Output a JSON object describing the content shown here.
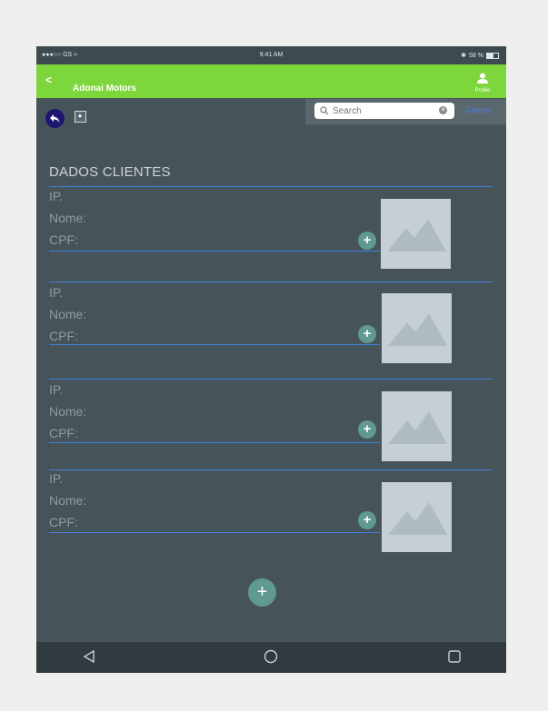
{
  "status_bar": {
    "carrier": "●●●○○ GS",
    "time": "9:41 AM",
    "battery": "58 %"
  },
  "app_bar": {
    "back_label": "<",
    "title": "Adonai Motors",
    "profile_label": "Profile"
  },
  "search": {
    "placeholder": "Search",
    "value": "Search",
    "cancel_label": "Cancel"
  },
  "section_title": "DADOS CLIENTES",
  "clients": [
    {
      "ip_label": "IP.",
      "nome_label": "Nome:",
      "cpf_label": "CPF:"
    },
    {
      "ip_label": "IP.",
      "nome_label": "Nome:",
      "cpf_label": "CPF:"
    },
    {
      "ip_label": "IP.",
      "nome_label": "Nome:",
      "cpf_label": "CPF:"
    },
    {
      "ip_label": "IP.",
      "nome_label": "Nome:",
      "cpf_label": "CPF:"
    }
  ],
  "add_small_label": "+",
  "fab_label": "+",
  "icons": {
    "back": "chevron-left-icon",
    "profile": "person-icon",
    "reply": "reply-arrow-icon",
    "upload": "upload-square-icon",
    "search": "search-icon",
    "clear": "clear-icon",
    "image": "image-placeholder-icon",
    "nav_back": "triangle-back-icon",
    "nav_home": "circle-home-icon",
    "nav_recent": "square-recent-icon"
  },
  "colors": {
    "app_bar": "#7ed63d",
    "background": "#46545a",
    "divider": "#3f7fdc",
    "accent_button": "#5f9991"
  }
}
